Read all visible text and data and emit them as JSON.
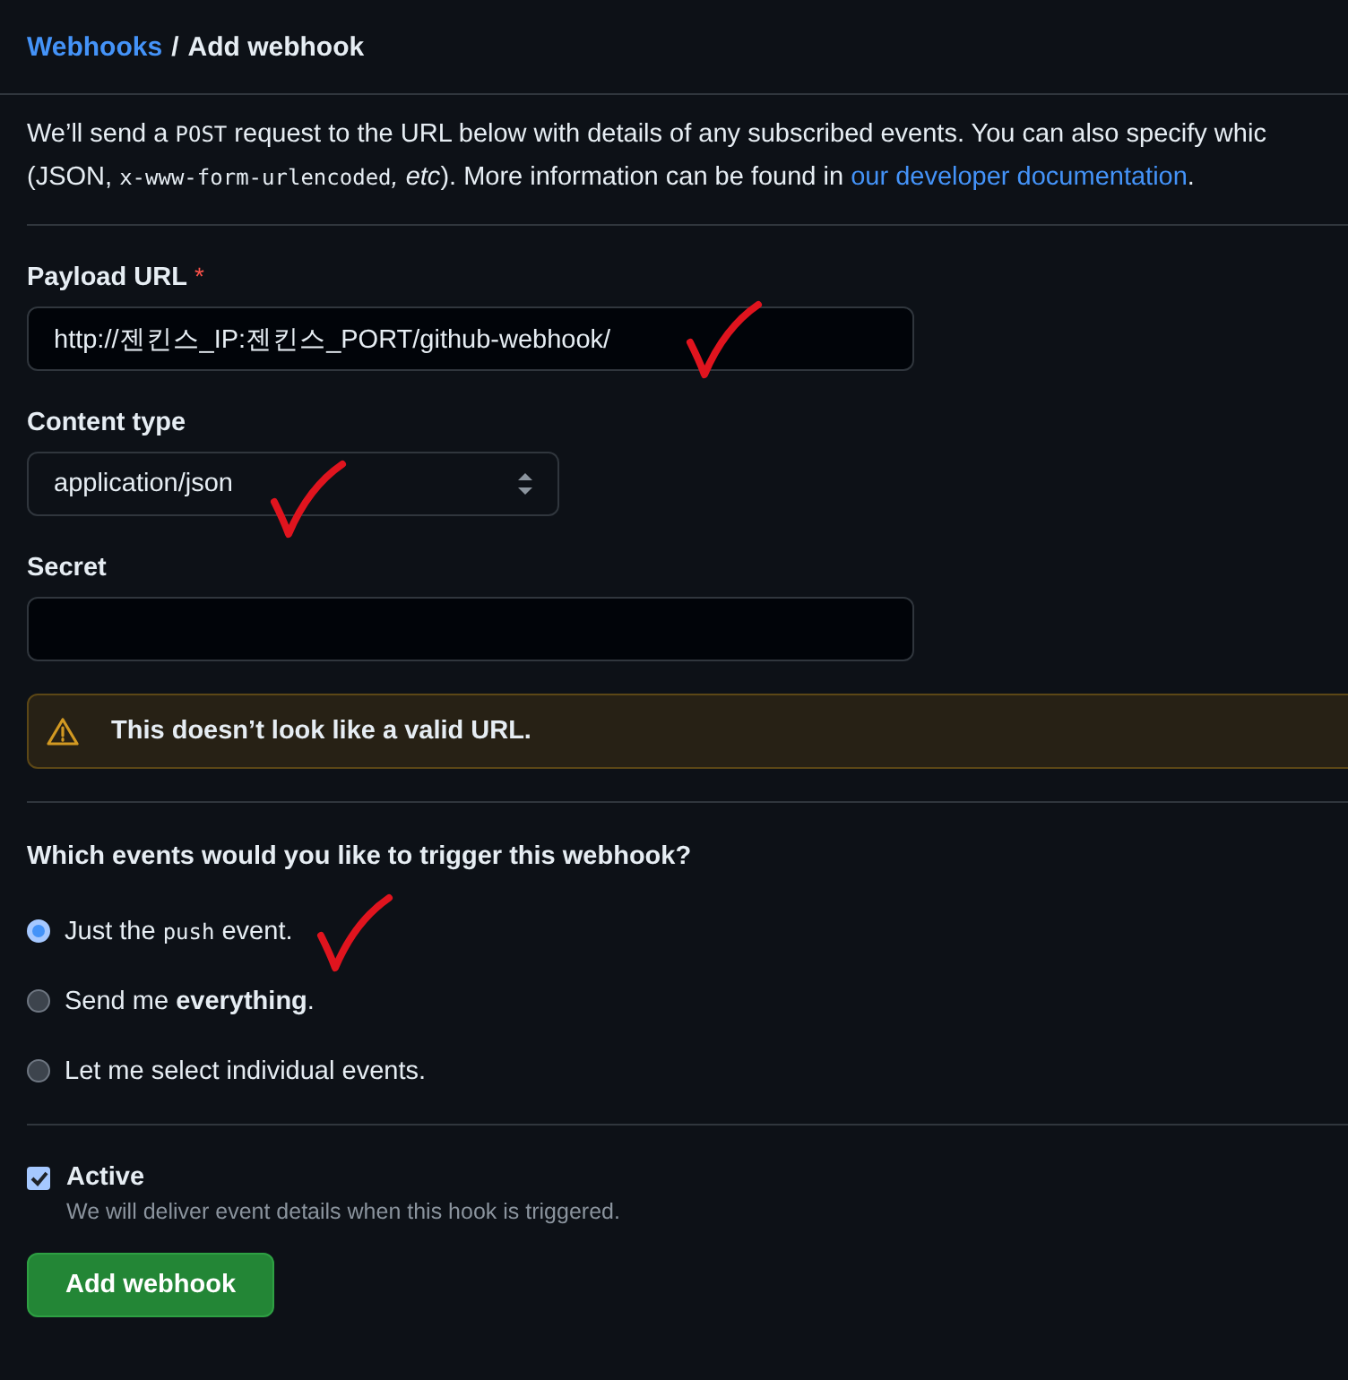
{
  "breadcrumb": {
    "parent": "Webhooks",
    "separator": "/",
    "current": "Add webhook"
  },
  "intro": [
    [
      {
        "kind": "text",
        "text": "We’ll send a "
      },
      {
        "kind": "code",
        "text": "POST"
      },
      {
        "kind": "text",
        "text": " request to the URL below with details of any subscribed events. You can also specify whic"
      }
    ],
    [
      {
        "kind": "text",
        "text": "(JSON, "
      },
      {
        "kind": "code",
        "text": "x-www-form-urlencoded"
      },
      {
        "kind": "italic",
        "text": ", etc"
      },
      {
        "kind": "text",
        "text": "). More information can be found in "
      },
      {
        "kind": "link",
        "text": "our developer documentation"
      },
      {
        "kind": "text",
        "text": "."
      }
    ]
  ],
  "payload_url": {
    "label": "Payload URL",
    "required_mark": "*",
    "value": "http://젠킨스_IP:젠킨스_PORT/github-webhook/"
  },
  "content_type": {
    "label": "Content type",
    "value": "application/json"
  },
  "secret": {
    "label": "Secret"
  },
  "warning": "This doesn’t look like a valid URL.",
  "events": {
    "question": "Which events would you like to trigger this webhook?",
    "options": [
      {
        "selected": true,
        "label": [
          {
            "kind": "text",
            "text": "Just the "
          },
          {
            "kind": "code",
            "text": "push"
          },
          {
            "kind": "text",
            "text": " event."
          }
        ]
      },
      {
        "selected": false,
        "label": [
          {
            "kind": "text",
            "text": "Send me "
          },
          {
            "kind": "bold",
            "text": "everything"
          },
          {
            "kind": "text",
            "text": "."
          }
        ]
      },
      {
        "selected": false,
        "label": [
          {
            "kind": "text",
            "text": "Let me select individual events."
          }
        ]
      }
    ]
  },
  "active": {
    "label": "Active",
    "checked": true,
    "description": "We will deliver event details when this hook is triggered."
  },
  "submit": "Add webhook"
}
